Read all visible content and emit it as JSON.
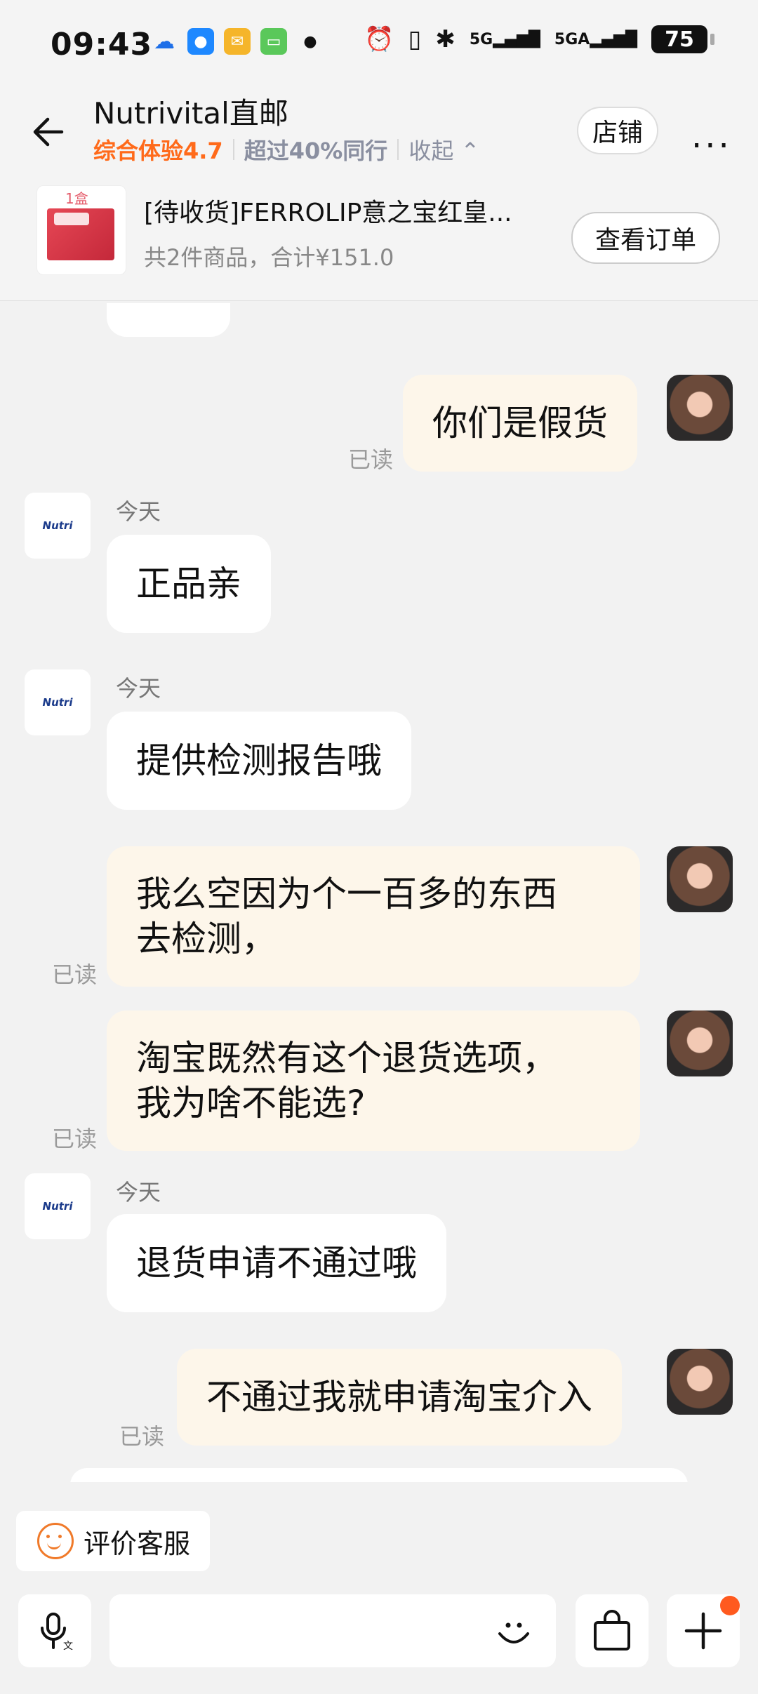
{
  "status_bar": {
    "time": "09:43",
    "battery": "75"
  },
  "header": {
    "shop_name": "Nutrivital直邮",
    "experience": "综合体验4.7",
    "peer": "超过40%同行",
    "collapse": "收起",
    "shop_button": "店铺",
    "more_icon": "more-icon"
  },
  "order": {
    "image_tag": "1盒",
    "title": "[待收货]FERROLIP意之宝红皇...",
    "summary": "共2件商品，合计¥151.0",
    "view_button": "查看订单"
  },
  "messages": [
    {
      "from": "user",
      "text": "你们是假货",
      "status": "已读"
    },
    {
      "from": "shop",
      "day": "今天",
      "text": "正品亲"
    },
    {
      "from": "shop",
      "day": "今天",
      "text": "提供检测报告哦"
    },
    {
      "from": "user",
      "line1": "我么空因为个一百多的东西",
      "line2": "去检测，",
      "status": "已读"
    },
    {
      "from": "user",
      "line1": "淘宝既然有这个退货选项，",
      "line2": "我为啥不能选?",
      "status": "已读"
    },
    {
      "from": "shop",
      "day": "今天",
      "text": "退货申请不通过哦"
    },
    {
      "from": "user",
      "text": "不通过我就申请淘宝介入",
      "status": "已读"
    }
  ],
  "shop_avatar_text": "Nutri",
  "rate_button": "评价客服",
  "colors": {
    "accent": "#ff6a1a",
    "out_bubble": "#fdf6ea",
    "in_bubble": "#ffffff"
  }
}
